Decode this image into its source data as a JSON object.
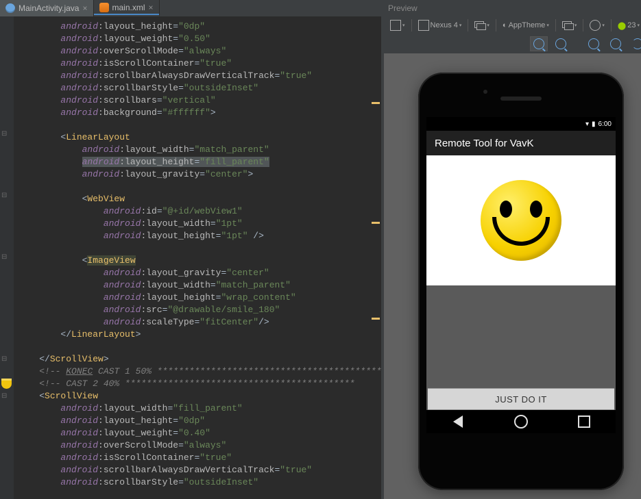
{
  "tabs": {
    "file1": "MainActivity.java",
    "file2": "main.xml"
  },
  "code": {
    "prefix": "android",
    "l0": {
      "a": "layout_height",
      "v": "\"0dp\""
    },
    "l1": {
      "a": "layout_weight",
      "v": "\"0.50\""
    },
    "l2": {
      "a": "overScrollMode",
      "v": "\"always\""
    },
    "l3": {
      "a": "isScrollContainer",
      "v": "\"true\""
    },
    "l4": {
      "a": "scrollbarAlwaysDrawVerticalTrack",
      "v": "\"true\""
    },
    "l5": {
      "a": "scrollbarStyle",
      "v": "\"outsideInset\""
    },
    "l6": {
      "a": "scrollbars",
      "v": "\"vertical\""
    },
    "l7": {
      "a": "background",
      "v": "\"#ffffff\""
    },
    "tag_ll": "LinearLayout",
    "ll1": {
      "a": "layout_width",
      "v": "\"match_parent\""
    },
    "ll2": {
      "a": "layout_height",
      "v": "\"fill_parent\""
    },
    "ll3": {
      "a": "layout_gravity",
      "v": "\"center\""
    },
    "tag_wv": "WebView",
    "wv1": {
      "a": "id",
      "v": "\"@+id/webView1\""
    },
    "wv2": {
      "a": "layout_width",
      "v": "\"1pt\""
    },
    "wv3": {
      "a": "layout_height",
      "v": "\"1pt\""
    },
    "tag_iv": "ImageView",
    "iv1": {
      "a": "layout_gravity",
      "v": "\"center\""
    },
    "iv2": {
      "a": "layout_width",
      "v": "\"match_parent\""
    },
    "iv3": {
      "a": "layout_height",
      "v": "\"wrap_content\""
    },
    "iv4": {
      "a": "src",
      "v": "\"@drawable/smile_180\""
    },
    "iv5": {
      "a": "scaleType",
      "v": "\"fitCenter\""
    },
    "close_ll": "LinearLayout",
    "close_sv": "ScrollView",
    "cmt1_a": "<!-- ",
    "cmt1_u": "KONEC",
    "cmt1_b": " CAST 1 50% ",
    "cmt2": "<!-- CAST 2 40% ",
    "cmt_stars": "*******************************************",
    "tag_sv": "ScrollView",
    "sv1": {
      "a": "layout_width",
      "v": "\"fill_parent\""
    },
    "sv2": {
      "a": "layout_height",
      "v": "\"0dp\""
    },
    "sv3": {
      "a": "layout_weight",
      "v": "\"0.40\""
    },
    "sv4": {
      "a": "overScrollMode",
      "v": "\"always\""
    },
    "sv5": {
      "a": "isScrollContainer",
      "v": "\"true\""
    },
    "sv6": {
      "a": "scrollbarAlwaysDrawVerticalTrack",
      "v": "\"true\""
    },
    "sv7": {
      "a": "scrollbarStyle",
      "v": "\"outsideInset\""
    }
  },
  "preview": {
    "title": "Preview",
    "device": "Nexus 4",
    "theme": "AppTheme",
    "api": "23",
    "app_title": "Remote Tool for VavK",
    "clock": "6:00",
    "button": "JUST DO IT"
  }
}
